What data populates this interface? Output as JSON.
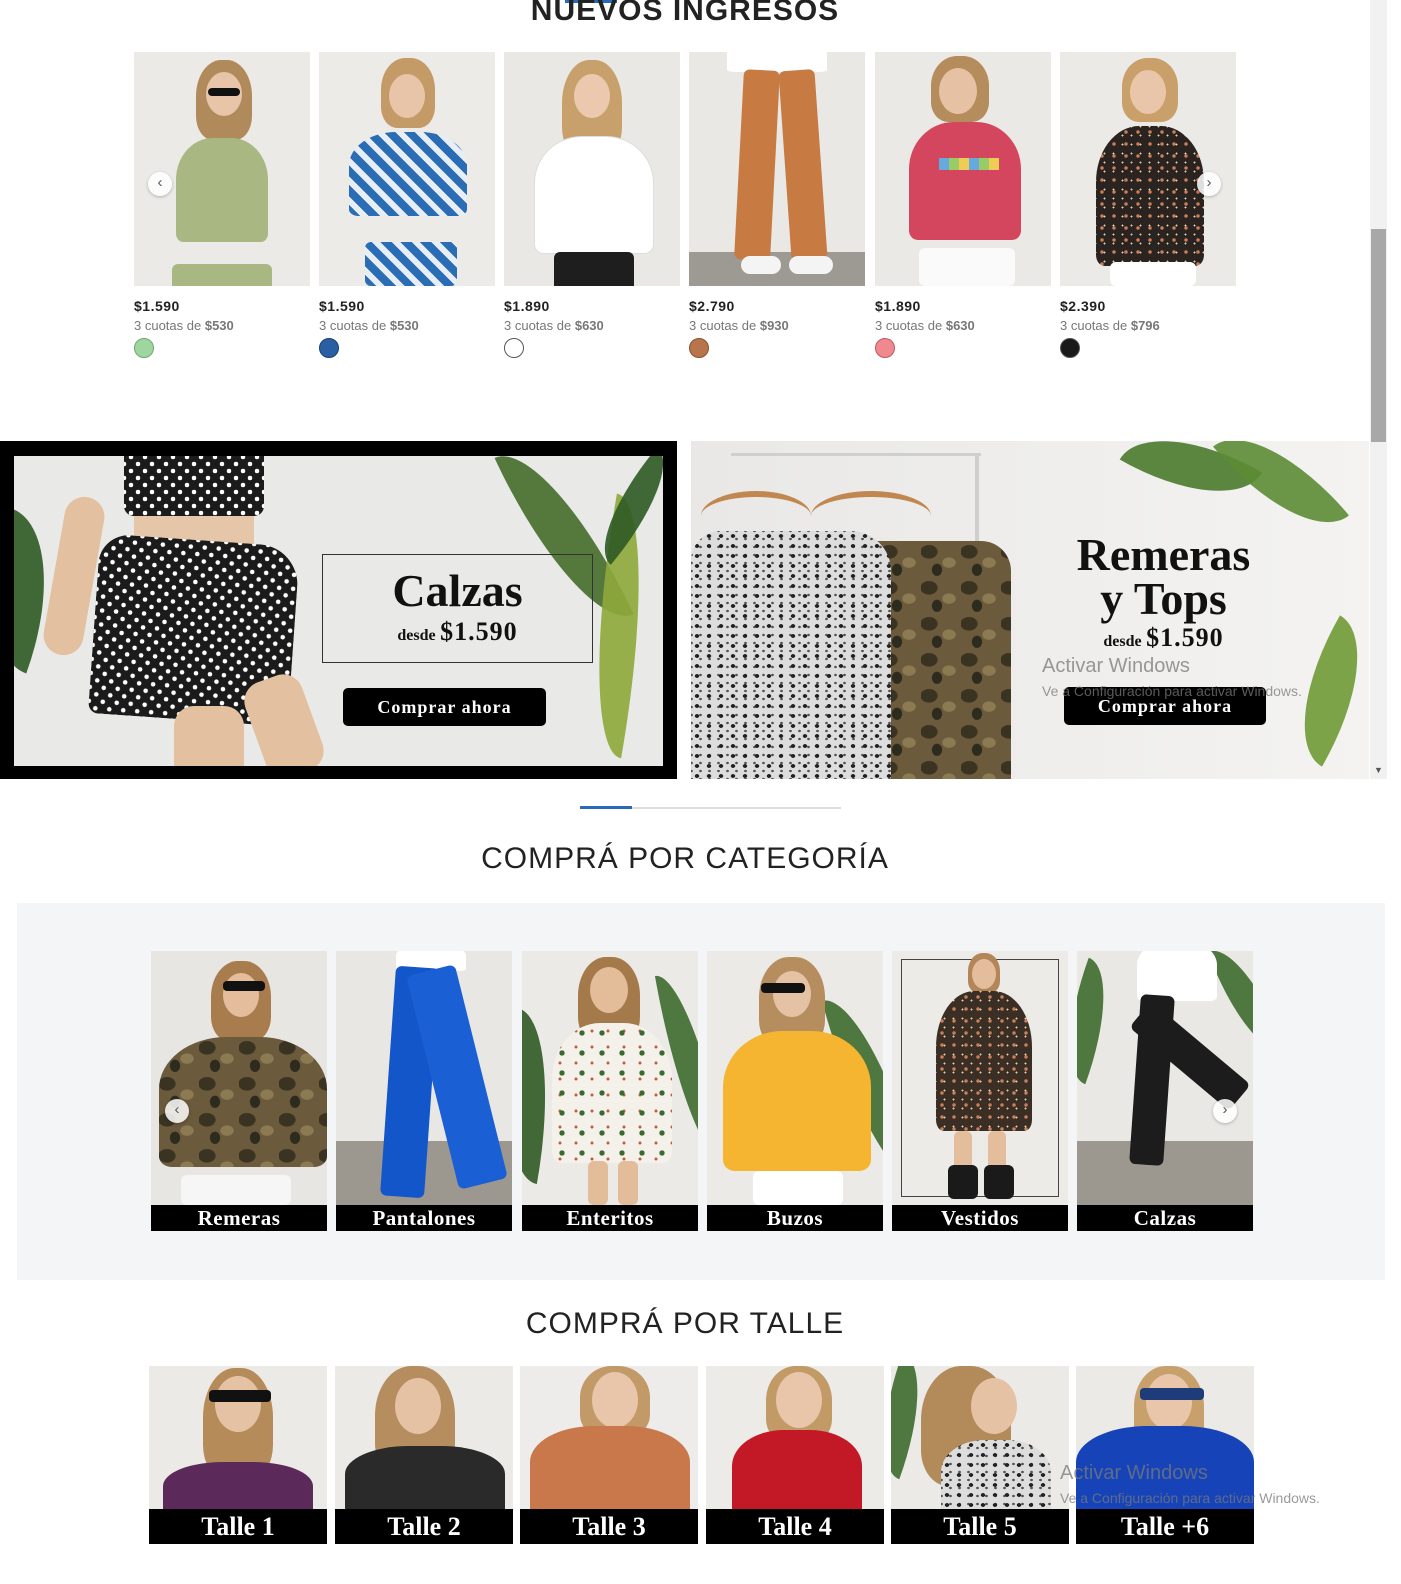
{
  "nuevos": {
    "title": "NUEVOS INGRESOS",
    "products": [
      {
        "price": "$1.590",
        "cuotas_prefix": "3 cuotas de",
        "cuotas_value": "$530",
        "swatch": "#9fd6a0"
      },
      {
        "price": "$1.590",
        "cuotas_prefix": "3 cuotas de",
        "cuotas_value": "$530",
        "swatch": "#2a5fa3"
      },
      {
        "price": "$1.890",
        "cuotas_prefix": "3 cuotas de",
        "cuotas_value": "$630",
        "swatch": "#ffffff"
      },
      {
        "price": "$2.790",
        "cuotas_prefix": "3 cuotas de",
        "cuotas_value": "$930",
        "swatch": "#b8744a"
      },
      {
        "price": "$1.890",
        "cuotas_prefix": "3 cuotas de",
        "cuotas_value": "$630",
        "swatch": "#f08890"
      },
      {
        "price": "$2.390",
        "cuotas_prefix": "3 cuotas de",
        "cuotas_value": "$796",
        "swatch": "#1a1a1a"
      }
    ],
    "prev_icon": "‹",
    "next_icon": "›"
  },
  "banners": {
    "left": {
      "title": "Calzas",
      "desde": "desde",
      "price": "$1.590",
      "button": "Comprar ahora"
    },
    "right": {
      "title_line1": "Remeras",
      "title_line2": "y Tops",
      "desde": "desde",
      "price": "$1.590",
      "button": "Comprar ahora"
    }
  },
  "watermark": {
    "line1": "Activar Windows",
    "line2": "Ve a Configuración para activar Windows."
  },
  "categorias": {
    "title": "COMPRÁ POR CATEGORÍA",
    "items": [
      "Remeras",
      "Pantalones",
      "Enteritos",
      "Buzos",
      "Vestidos",
      "Calzas"
    ],
    "prev_icon": "‹",
    "next_icon": "›"
  },
  "talles": {
    "title": "COMPRÁ POR TALLE",
    "items": [
      "Talle 1",
      "Talle 2",
      "Talle 3",
      "Talle 4",
      "Talle 5",
      "Talle +6"
    ]
  },
  "scrollbar": {
    "down_icon": "▼"
  },
  "colors": {
    "accent": "#2a6ab8",
    "banner_black": "#000000",
    "panel_bg": "#f4f5f6"
  }
}
